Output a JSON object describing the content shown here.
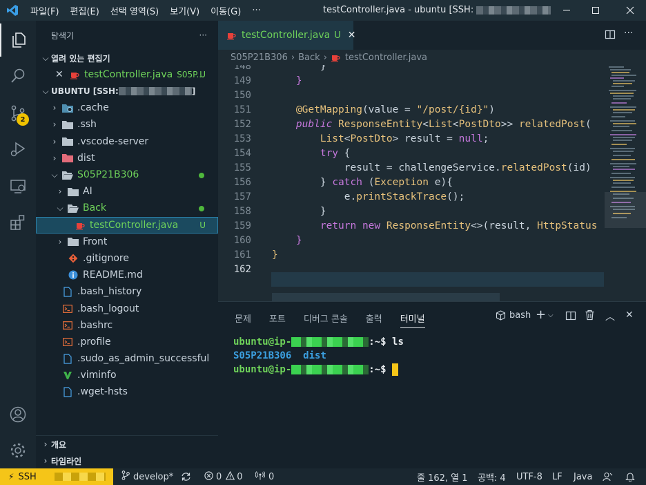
{
  "menu": [
    "파일(F)",
    "편집(E)",
    "선택 영역(S)",
    "보기(V)",
    "이동(G)",
    "···"
  ],
  "window_title": "testController.java - ubuntu [SSH: ",
  "window_title_tail": "...",
  "activity": {
    "scm_badge": "2"
  },
  "sidebar": {
    "title": "탐색기",
    "more": "···",
    "open_editors_label": "열려 있는 편집기",
    "open_editor": {
      "name": "testController.java",
      "path": "S05P...",
      "status": "U"
    },
    "workspace_label": "UBUNTU [SSH: ",
    "workspace_label_tail": "]",
    "tree": [
      {
        "name": ".cache"
      },
      {
        "name": ".ssh"
      },
      {
        "name": ".vscode-server"
      },
      {
        "name": "dist"
      },
      {
        "name": "S05P21B306"
      },
      {
        "name": "AI"
      },
      {
        "name": "Back"
      },
      {
        "name": "testController.java",
        "status": "U"
      },
      {
        "name": "Front"
      },
      {
        "name": ".gitignore"
      },
      {
        "name": "README.md"
      },
      {
        "name": ".bash_history"
      },
      {
        "name": ".bash_logout"
      },
      {
        "name": ".bashrc"
      },
      {
        "name": ".profile"
      },
      {
        "name": ".sudo_as_admin_successful"
      },
      {
        "name": ".viminfo"
      },
      {
        "name": ".wget-hsts"
      }
    ],
    "outline_label": "개요",
    "timeline_label": "타임라인"
  },
  "editor": {
    "tab": {
      "name": "testController.java",
      "status": "U"
    },
    "breadcrumb": [
      "S05P21B306",
      "Back",
      "testController.java"
    ],
    "lines": [
      {
        "n": "148",
        "code": [
          [
            "",
            "        }"
          ]
        ]
      },
      {
        "n": "149",
        "code": [
          [
            "br",
            "    }"
          ]
        ]
      },
      {
        "n": "150",
        "code": [
          [
            "",
            ""
          ]
        ]
      },
      {
        "n": "151",
        "code": [
          [
            "an",
            "    @GetMapping"
          ],
          [
            "",
            "(value = "
          ],
          [
            "st",
            "\"/post/{id}\""
          ],
          [
            "",
            ")"
          ]
        ]
      },
      {
        "n": "152",
        "code": [
          [
            "kwi",
            "    public "
          ],
          [
            "ty",
            "ResponseEntity"
          ],
          [
            "",
            "<"
          ],
          [
            "ty",
            "List"
          ],
          [
            "",
            "<"
          ],
          [
            "ty",
            "PostDto"
          ],
          [
            "",
            ">> "
          ],
          [
            "fn",
            "relatedPost"
          ],
          [
            "",
            "("
          ]
        ]
      },
      {
        "n": "153",
        "code": [
          [
            "ty",
            "        List"
          ],
          [
            "",
            "<"
          ],
          [
            "ty",
            "PostDto"
          ],
          [
            "",
            "> result = "
          ],
          [
            "kw",
            "null"
          ],
          [
            "",
            ";"
          ]
        ]
      },
      {
        "n": "154",
        "code": [
          [
            "kw",
            "        try"
          ],
          [
            "",
            " {"
          ]
        ]
      },
      {
        "n": "155",
        "code": [
          [
            "",
            "            result = challengeService."
          ],
          [
            "fn",
            "relatedPost"
          ],
          [
            "",
            "(id)"
          ]
        ]
      },
      {
        "n": "156",
        "code": [
          [
            "",
            "        } "
          ],
          [
            "kw",
            "catch"
          ],
          [
            "",
            " ("
          ],
          [
            "ty",
            "Exception"
          ],
          [
            "",
            " e){"
          ]
        ]
      },
      {
        "n": "157",
        "code": [
          [
            "",
            "            e."
          ],
          [
            "fn",
            "printStackTrace"
          ],
          [
            "",
            "();"
          ]
        ]
      },
      {
        "n": "158",
        "code": [
          [
            "",
            "        }"
          ]
        ]
      },
      {
        "n": "159",
        "code": [
          [
            "kw",
            "        return "
          ],
          [
            "kw",
            "new "
          ],
          [
            "ty",
            "ResponseEntity"
          ],
          [
            "",
            "<>(result, "
          ],
          [
            "ty",
            "HttpStatus"
          ]
        ]
      },
      {
        "n": "160",
        "code": [
          [
            "br",
            "    }"
          ]
        ]
      },
      {
        "n": "161",
        "code": [
          [
            "ty",
            "}"
          ]
        ]
      },
      {
        "n": "162",
        "code": [
          [
            "",
            ""
          ]
        ]
      }
    ]
  },
  "panel": {
    "tabs": [
      "문제",
      "포트",
      "디버그 콘솔",
      "출력",
      "터미널"
    ],
    "active_tab": "터미널",
    "shell": "bash",
    "terminal": {
      "prompt_user": "ubuntu@ip-",
      "prompt_tail": ":~$",
      "command": " ls",
      "ls_output": [
        "S05P21B306",
        "dist"
      ]
    }
  },
  "statusbar": {
    "remote": "SSH",
    "branch": "develop*",
    "errors": "0",
    "warnings": "0",
    "ports": "0",
    "position": "줄 162, 열 1",
    "spaces": "공백: 4",
    "encoding": "UTF-8",
    "eol": "LF",
    "language": "Java"
  },
  "colors": {
    "accent": "#f5c518",
    "git_untracked": "#6fd35a",
    "selection": "#1b4a5f",
    "java_icon": "#e8413a"
  }
}
